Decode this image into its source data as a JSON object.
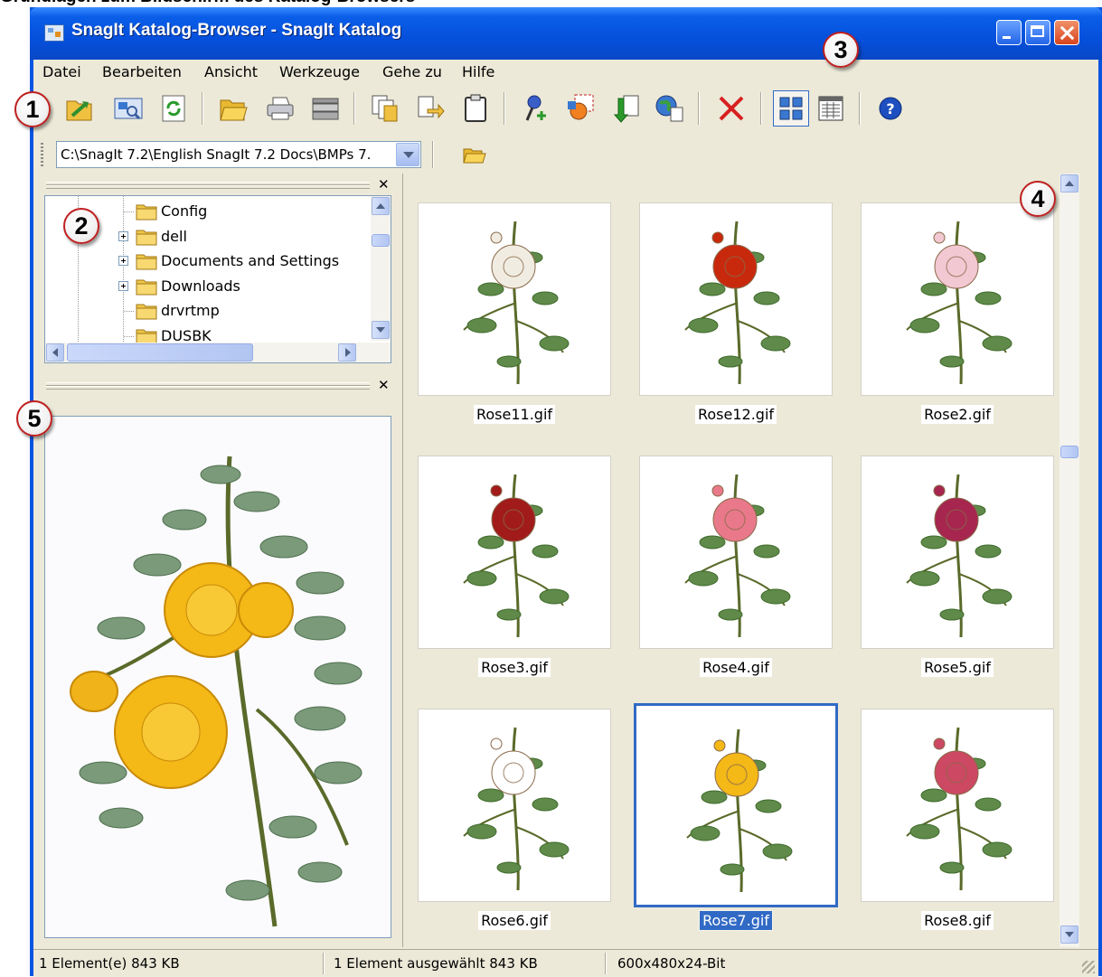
{
  "page_heading": "Grundlagen zum Bildschirm des Katalog-Browsers",
  "window": {
    "title": "SnagIt Katalog-Browser - SnagIt Katalog",
    "title_icon": "catalog-app-icon"
  },
  "menu": {
    "items": [
      "Datei",
      "Bearbeiten",
      "Ansicht",
      "Werkzeuge",
      "Gehe zu",
      "Hilfe"
    ]
  },
  "toolbar": {
    "buttons": [
      "folder-browse-icon",
      "catalog-icon",
      "refresh-icon",
      "open-folder-icon",
      "print-icon",
      "scanner-icon",
      "copy-icon",
      "copy-to-icon",
      "paste-icon",
      "pin-add-icon",
      "image-convert-icon",
      "move-files-icon",
      "web-export-icon",
      "delete-icon",
      "thumbnail-view-icon",
      "details-view-icon",
      "help-icon"
    ]
  },
  "address": {
    "path": "C:\\SnagIt 7.2\\English SnagIt 7.2 Docs\\BMPs 7."
  },
  "tree": {
    "items": [
      {
        "label": "Config",
        "expandable": false
      },
      {
        "label": "dell",
        "expandable": true
      },
      {
        "label": "Documents and Settings",
        "expandable": true
      },
      {
        "label": "Downloads",
        "expandable": true
      },
      {
        "label": "drvrtmp",
        "expandable": false
      },
      {
        "label": "DUSBK",
        "expandable": false
      }
    ],
    "scroll_position": 0.2
  },
  "thumbnails": [
    {
      "name": "Rose11.gif",
      "selected": false,
      "flower_color": "#f1ece2"
    },
    {
      "name": "Rose12.gif",
      "selected": false,
      "flower_color": "#c8290d"
    },
    {
      "name": "Rose2.gif",
      "selected": false,
      "flower_color": "#f2c8d2"
    },
    {
      "name": "Rose3.gif",
      "selected": false,
      "flower_color": "#a11b1b"
    },
    {
      "name": "Rose4.gif",
      "selected": false,
      "flower_color": "#e9798a"
    },
    {
      "name": "Rose5.gif",
      "selected": false,
      "flower_color": "#a6264f"
    },
    {
      "name": "Rose6.gif",
      "selected": false,
      "flower_color": "#ffffff"
    },
    {
      "name": "Rose7.gif",
      "selected": true,
      "flower_color": "#f4b817"
    },
    {
      "name": "Rose8.gif",
      "selected": false,
      "flower_color": "#cc4863"
    }
  ],
  "thumbnail_scroll_position": 0.35,
  "status": {
    "items": "1 Element(e)  843 KB",
    "selected": "1 Element ausgewählt 843 KB",
    "image_info": "600x480x24-Bit"
  },
  "callouts": [
    "1",
    "2",
    "3",
    "4",
    "5"
  ],
  "colors": {
    "titlebar": "#0a55e0",
    "selection": "#316ac5",
    "background": "#ece9d8",
    "callout_border": "#c02020"
  }
}
